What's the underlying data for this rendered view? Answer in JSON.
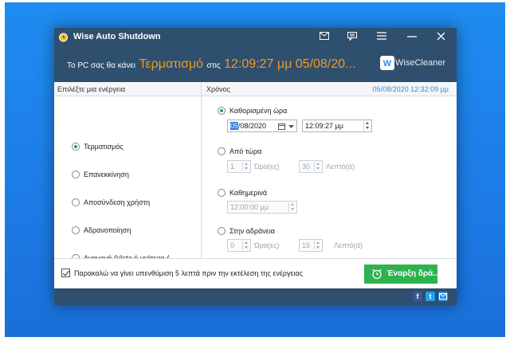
{
  "window": {
    "title": "Wise Auto Shutdown"
  },
  "banner": {
    "prefix": "Το PC σας θα κάνει",
    "action": "Τερματισμό",
    "mid": "στις",
    "time": "12:09:27 μμ 05/08/20...",
    "brand": "WiseCleaner"
  },
  "left": {
    "header": "Επιλέξτε μια ενέργεια",
    "options": [
      {
        "label": "Τερματισμός",
        "checked": true
      },
      {
        "label": "Επανεκκίνηση",
        "checked": false
      },
      {
        "label": "Αποσύνδεση χρήστη",
        "checked": false
      },
      {
        "label": "Αδρανοποίηση",
        "checked": false
      },
      {
        "label": "Αναμονή (Vista ή νεότερη έ...",
        "checked": false
      }
    ]
  },
  "right": {
    "header": "Χρόνος",
    "current_datetime": "05/08/2020 12:32:09 μμ",
    "specific_time": {
      "label": "Καθορισμένη ώρα",
      "checked": true,
      "date_selected": "05",
      "date_rest": "/08/2020",
      "time": "12:09:27 μμ"
    },
    "from_now": {
      "label": "Από τώρα",
      "checked": false,
      "hours": "1",
      "hours_unit": "Ώρα(ες)",
      "minutes": "30",
      "minutes_unit": "Λεπτό(ά)"
    },
    "daily": {
      "label": "Καθημερινά",
      "checked": false,
      "time": "12:00:00 μμ"
    },
    "idle": {
      "label": "Στην αδράνεια",
      "checked": false,
      "hours": "0",
      "hours_unit": "Ώρα(ες)",
      "minutes": "15",
      "minutes_unit": "Λεπτό(ά)"
    }
  },
  "footer": {
    "reminder_label": "Παρακαλώ να γίνει υπενθύμιση 5 λεπτά πριν την εκτέλεση της ενέργειας",
    "reminder_checked": true,
    "start_button": "Έναρξη δρά..."
  },
  "colors": {
    "titlebar": "#2e4f6e",
    "accent_orange": "#f39a1e",
    "accent_green": "#2eb24e",
    "accent_blue": "#2f8de4"
  }
}
